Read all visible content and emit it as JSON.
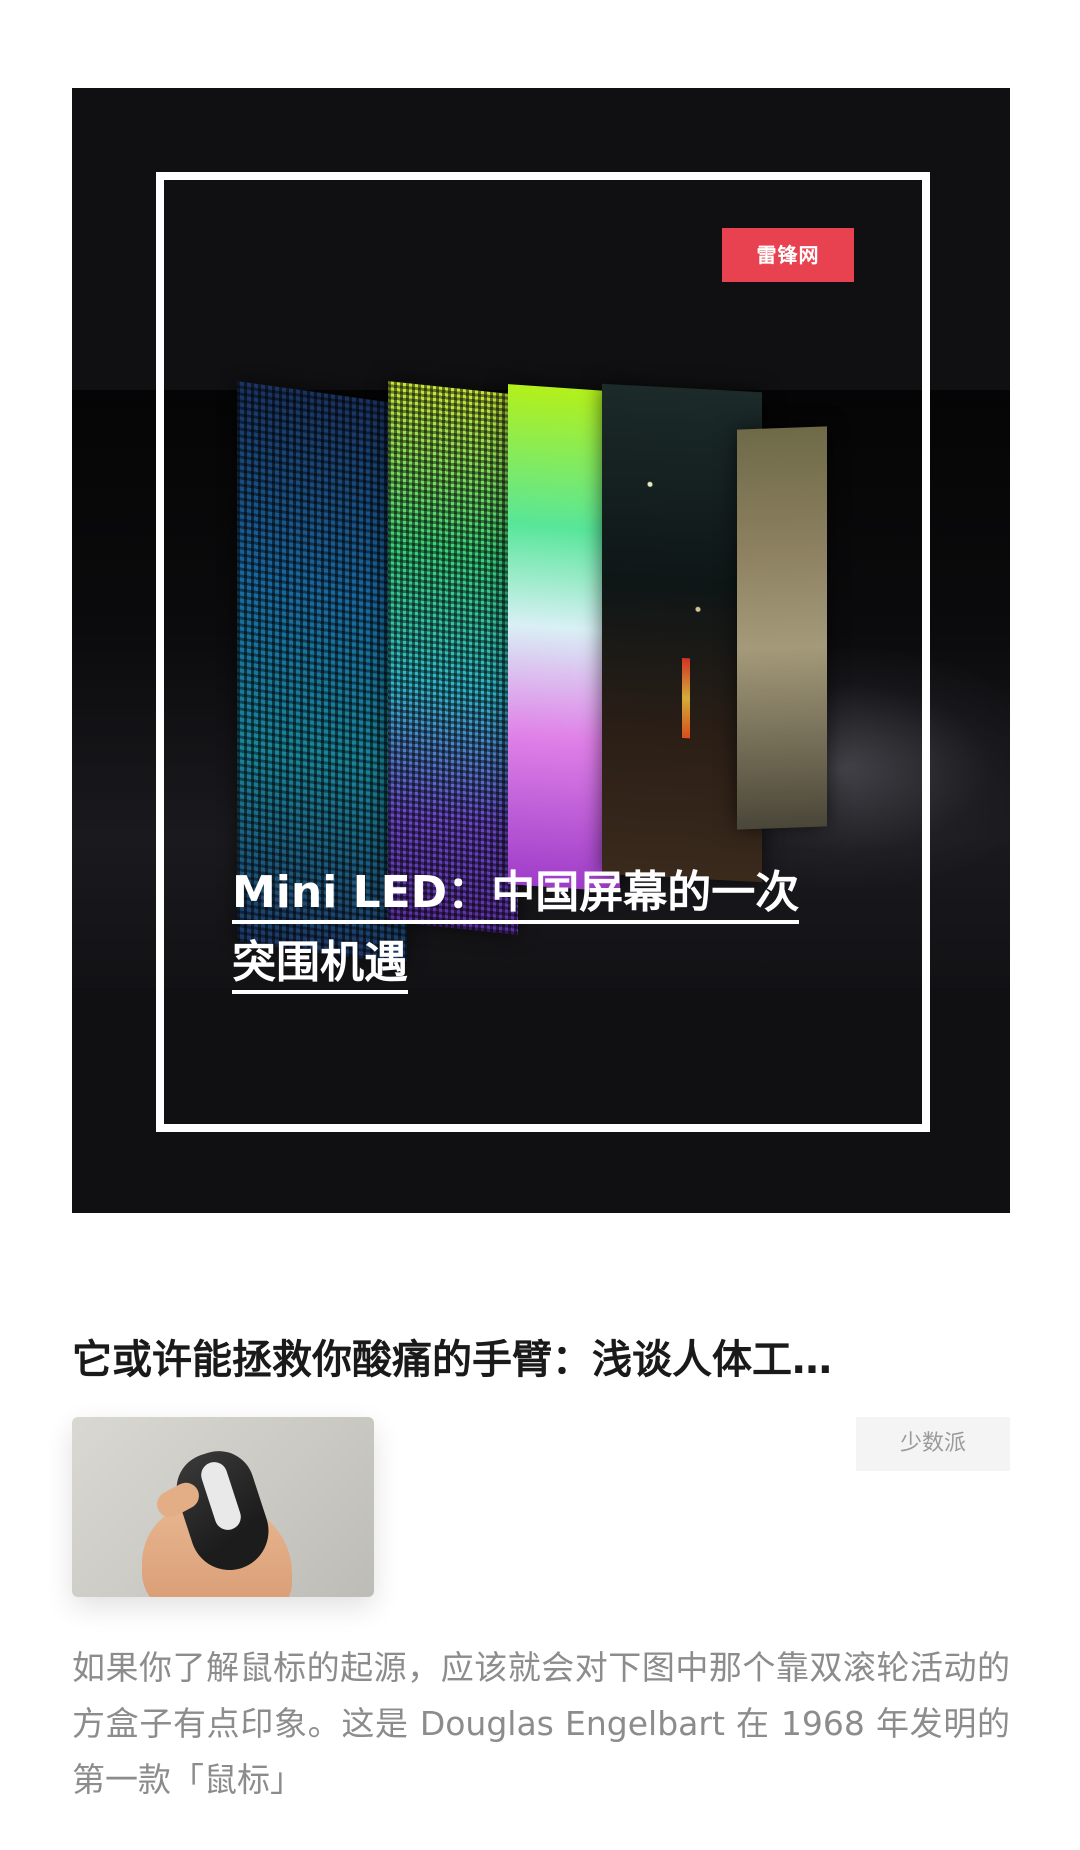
{
  "featured": {
    "source_label": "雷锋网",
    "title_line1": "Mini LED：中国屏幕的一次",
    "title_line2": "突围机遇",
    "colors": {
      "background": "#101012",
      "frame": "#ffffff",
      "tag": "#e8414f"
    }
  },
  "article": {
    "title": "它或许能拯救你酸痛的手臂：浅谈人体工…",
    "source_label": "少数派",
    "summary": "如果你了解鼠标的起源，应该就会对下图中那个靠双滚轮活动的方盒子有点印象。这是 Douglas Engelbart 在 1968 年发明的第一款「鼠标」",
    "thumbnail": "hand-holding-vertical-mouse"
  }
}
